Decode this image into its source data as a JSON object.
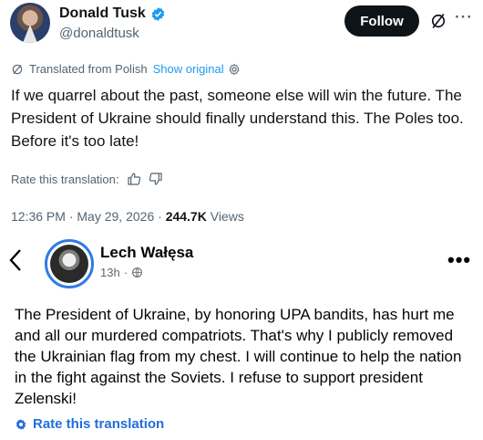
{
  "author": {
    "display_name": "Donald Tusk",
    "handle": "@donaldtusk",
    "verified": true,
    "follow_label": "Follow",
    "more_label": "···"
  },
  "translation": {
    "label": "Translated from Polish",
    "show_original": "Show original"
  },
  "tweet": {
    "text": "If we quarrel about the past, someone else will win the future. The President of Ukraine should finally understand this. The Poles too. Before it's too late!",
    "rate_label": "Rate this translation:",
    "time": "12:36 PM",
    "date": "May 29, 2026",
    "views_count": "244.7K",
    "views_label": "Views"
  },
  "embedded_post": {
    "name": "Lech Wałęsa",
    "age": "13h",
    "separator": "·",
    "more_label": "•••",
    "text": "The President of Ukraine, by honoring UPA bandits, has hurt me and all our murdered compatriots. That's why I publicly removed the Ukrainian flag from my chest. I will continue to help the nation in the fight against the Soviets. I refuse to support president Zelenski!",
    "rate_label": "Rate this translation"
  },
  "colors": {
    "accent": "#1d9bf0",
    "text": "#0f1419",
    "muted": "#536471",
    "fb_blue": "#216fdb",
    "follow_bg": "#0f1419"
  },
  "icons": {
    "verified": "verified-badge-icon",
    "grok": "grok-icon",
    "translate": "translate-slash-icon",
    "settings": "gear-icon",
    "thumbs_up": "thumbs-up-icon",
    "thumbs_down": "thumbs-down-icon",
    "back": "chevron-left-icon",
    "globe": "globe-icon"
  }
}
